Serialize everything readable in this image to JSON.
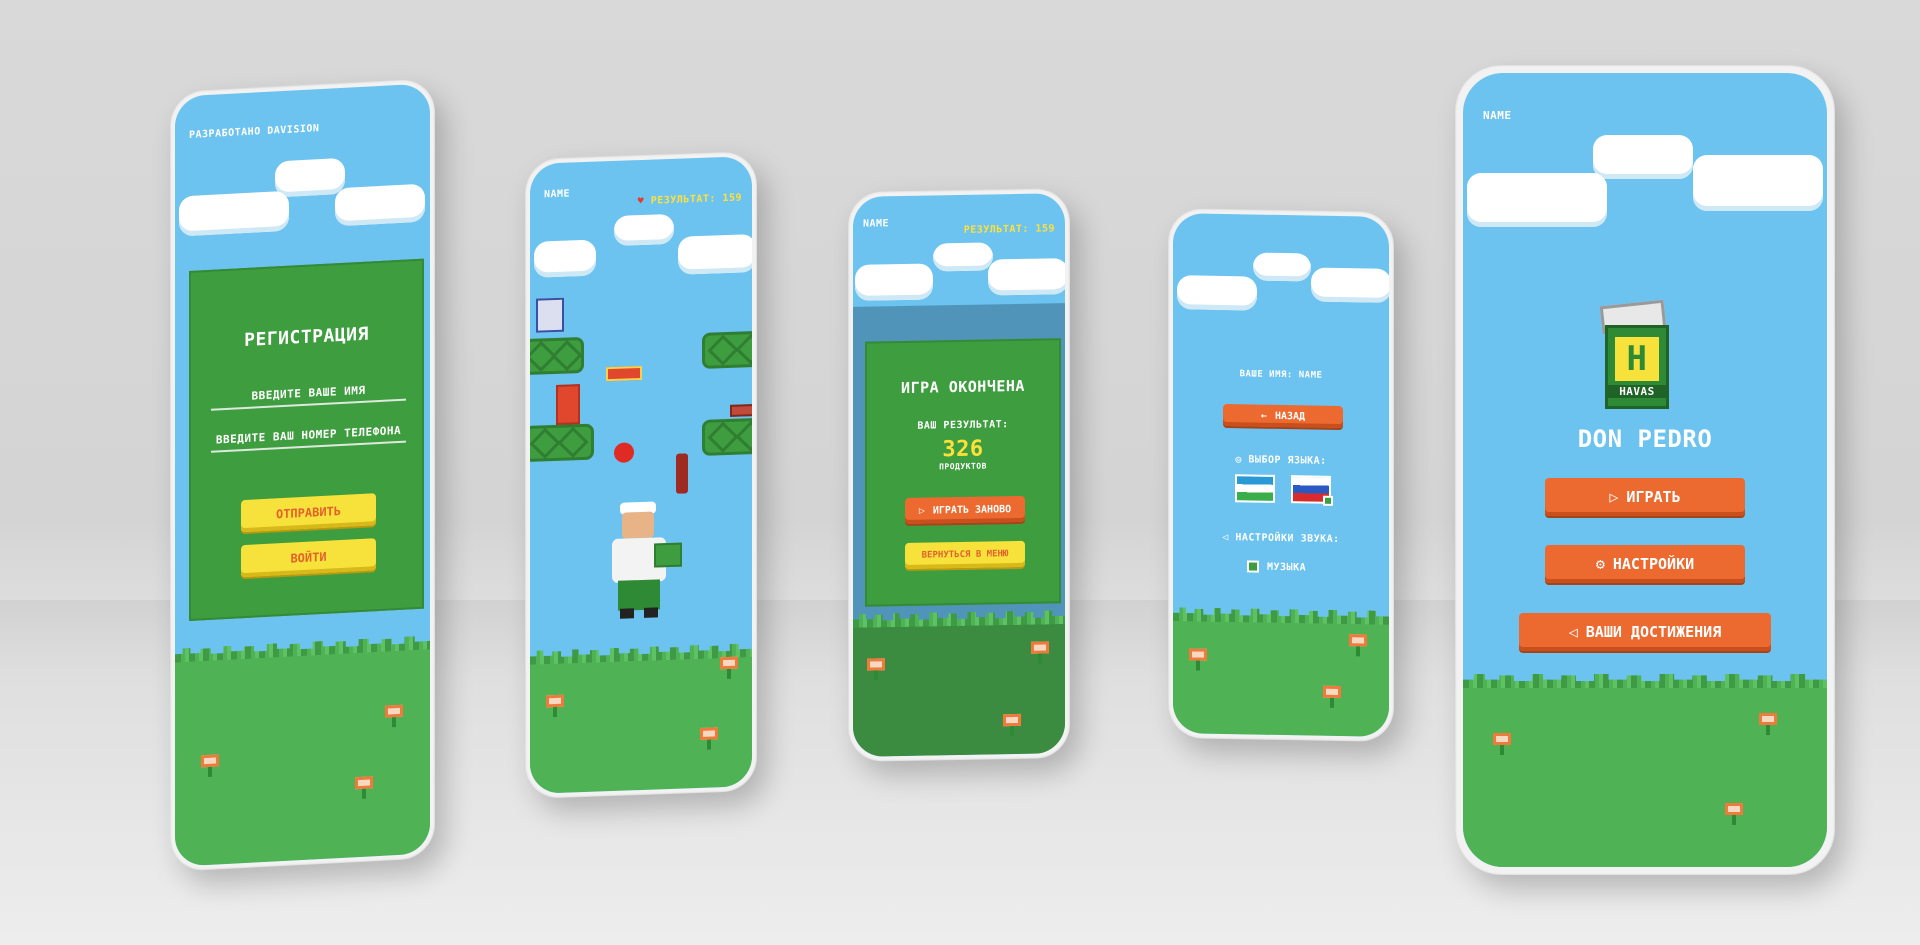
{
  "screens": {
    "registration": {
      "credit": "РАЗРАБОТАНО DAVISION",
      "title": "РЕГИСТРАЦИЯ",
      "name_placeholder": "ВВЕДИТЕ ВАШЕ ИМЯ",
      "phone_placeholder": "ВВЕДИТЕ ВАШ НОМЕР ТЕЛЕФОНА",
      "submit_label": "ОТПРАВИТЬ",
      "login_label": "ВОЙТИ"
    },
    "gameplay": {
      "player_name": "NAME",
      "score_label": "РЕЗУЛЬТАТ: 159"
    },
    "game_over": {
      "player_name": "NAME",
      "score_label": "РЕЗУЛЬТАТ: 159",
      "title": "ИГРА ОКОНЧЕНА",
      "result_label": "ВАШ РЕЗУЛЬТАТ:",
      "result_value": "326",
      "result_unit": "ПРОДУКТОВ",
      "play_again_label": "ИГРАТЬ ЗАНОВО",
      "back_to_menu_label": "ВЕРНУТЬСЯ В МЕНЮ"
    },
    "settings": {
      "your_name": "ВАШЕ ИМЯ: NAME",
      "back_label": "НАЗАД",
      "language_label": "ВЫБОР ЯЗЫКА:",
      "sound_label": "НАСТРОЙКИ ЗВУКА:",
      "music_label": "МУЗЫКА"
    },
    "menu": {
      "player_name": "NAME",
      "logo_letter": "H",
      "logo_brand": "HAVAS",
      "title": "DON PEDRO",
      "play_label": "ИГРАТЬ",
      "settings_label": "НАСТРОЙКИ",
      "achievements_label": "ВАШИ ДОСТИЖЕНИЯ"
    }
  },
  "colors": {
    "sky": "#6cc3ef",
    "grass": "#4fb356",
    "panel": "#3e9d3f",
    "button_yellow": "#f6e23a",
    "button_orange": "#ec6a30",
    "score_yellow": "#ffe03a"
  },
  "icons": {
    "play": "play-triangle-icon",
    "gear": "gear-icon",
    "back": "arrow-left-icon",
    "globe": "globe-icon",
    "speaker": "speaker-icon",
    "heart": "heart-icon"
  }
}
